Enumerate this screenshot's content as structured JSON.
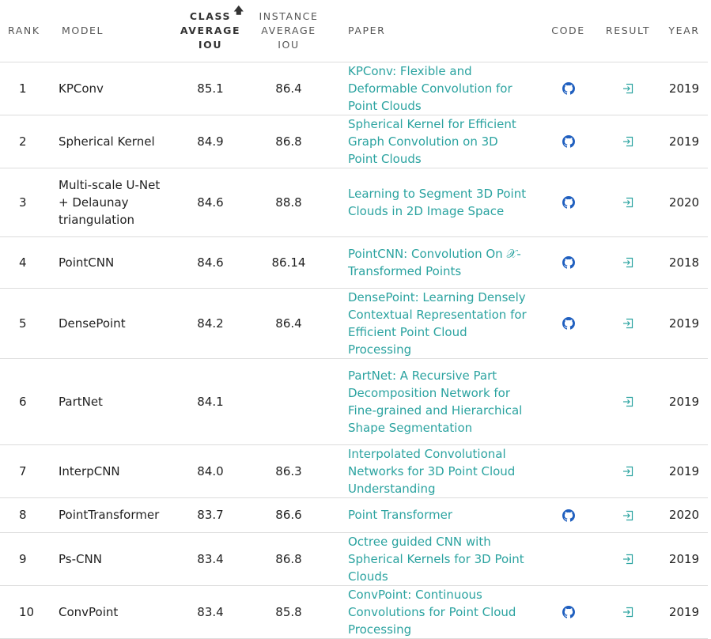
{
  "headers": {
    "rank": "RANK",
    "model": "MODEL",
    "class_avg": "CLASS AVERAGE IOU",
    "instance_avg": "INSTANCE AVERAGE IOU",
    "paper": "PAPER",
    "code": "CODE",
    "result": "RESULT",
    "year": "YEAR"
  },
  "sort": {
    "column": "class_avg",
    "direction": "descending",
    "icon": "arrow-up-icon"
  },
  "colors": {
    "link": "#2ba3a0",
    "github_icon": "#1f5fbf",
    "result_icon": "#2ba3a0",
    "divider": "#dcdcdc"
  },
  "rows": [
    {
      "rank": "1",
      "model": "KPConv",
      "class_avg": "85.1",
      "instance_avg": "86.4",
      "paper": "KPConv: Flexible and Deformable Convolution for Point Clouds",
      "has_code": true,
      "has_result": true,
      "year": "2019"
    },
    {
      "rank": "2",
      "model": "Spherical Kernel",
      "class_avg": "84.9",
      "instance_avg": "86.8",
      "paper": "Spherical Kernel for Efficient Graph Convolution on 3D Point Clouds",
      "has_code": true,
      "has_result": true,
      "year": "2019"
    },
    {
      "rank": "3",
      "model": "Multi-scale U-Net + Delaunay triangulation",
      "class_avg": "84.6",
      "instance_avg": "88.8",
      "paper": "Learning to Segment 3D Point Clouds in 2D Image Space",
      "has_code": true,
      "has_result": true,
      "year": "2020"
    },
    {
      "rank": "4",
      "model": "PointCNN",
      "class_avg": "84.6",
      "instance_avg": "86.14",
      "paper": "PointCNN: Convolution On 𝒳-Transformed Points",
      "has_code": true,
      "has_result": true,
      "year": "2018"
    },
    {
      "rank": "5",
      "model": "DensePoint",
      "class_avg": "84.2",
      "instance_avg": "86.4",
      "paper": "DensePoint: Learning Densely Contextual Representation for Efficient Point Cloud Processing",
      "has_code": true,
      "has_result": true,
      "year": "2019"
    },
    {
      "rank": "6",
      "model": "PartNet",
      "class_avg": "84.1",
      "instance_avg": "",
      "paper": "PartNet: A Recursive Part Decomposition Network for Fine-grained and Hierarchical Shape Segmentation",
      "has_code": false,
      "has_result": true,
      "year": "2019"
    },
    {
      "rank": "7",
      "model": "InterpCNN",
      "class_avg": "84.0",
      "instance_avg": "86.3",
      "paper": "Interpolated Convolutional Networks for 3D Point Cloud Understanding",
      "has_code": false,
      "has_result": true,
      "year": "2019"
    },
    {
      "rank": "8",
      "model": "PointTransformer",
      "class_avg": "83.7",
      "instance_avg": "86.6",
      "paper": "Point Transformer",
      "has_code": true,
      "has_result": true,
      "year": "2020"
    },
    {
      "rank": "9",
      "model": "Ps-CNN",
      "class_avg": "83.4",
      "instance_avg": "86.8",
      "paper": "Octree guided CNN with Spherical Kernels for 3D Point Clouds",
      "has_code": false,
      "has_result": true,
      "year": "2019"
    },
    {
      "rank": "10",
      "model": "ConvPoint",
      "class_avg": "83.4",
      "instance_avg": "85.8",
      "paper": "ConvPoint: Continuous Convolutions for Point Cloud Processing",
      "has_code": true,
      "has_result": true,
      "year": "2019"
    }
  ]
}
